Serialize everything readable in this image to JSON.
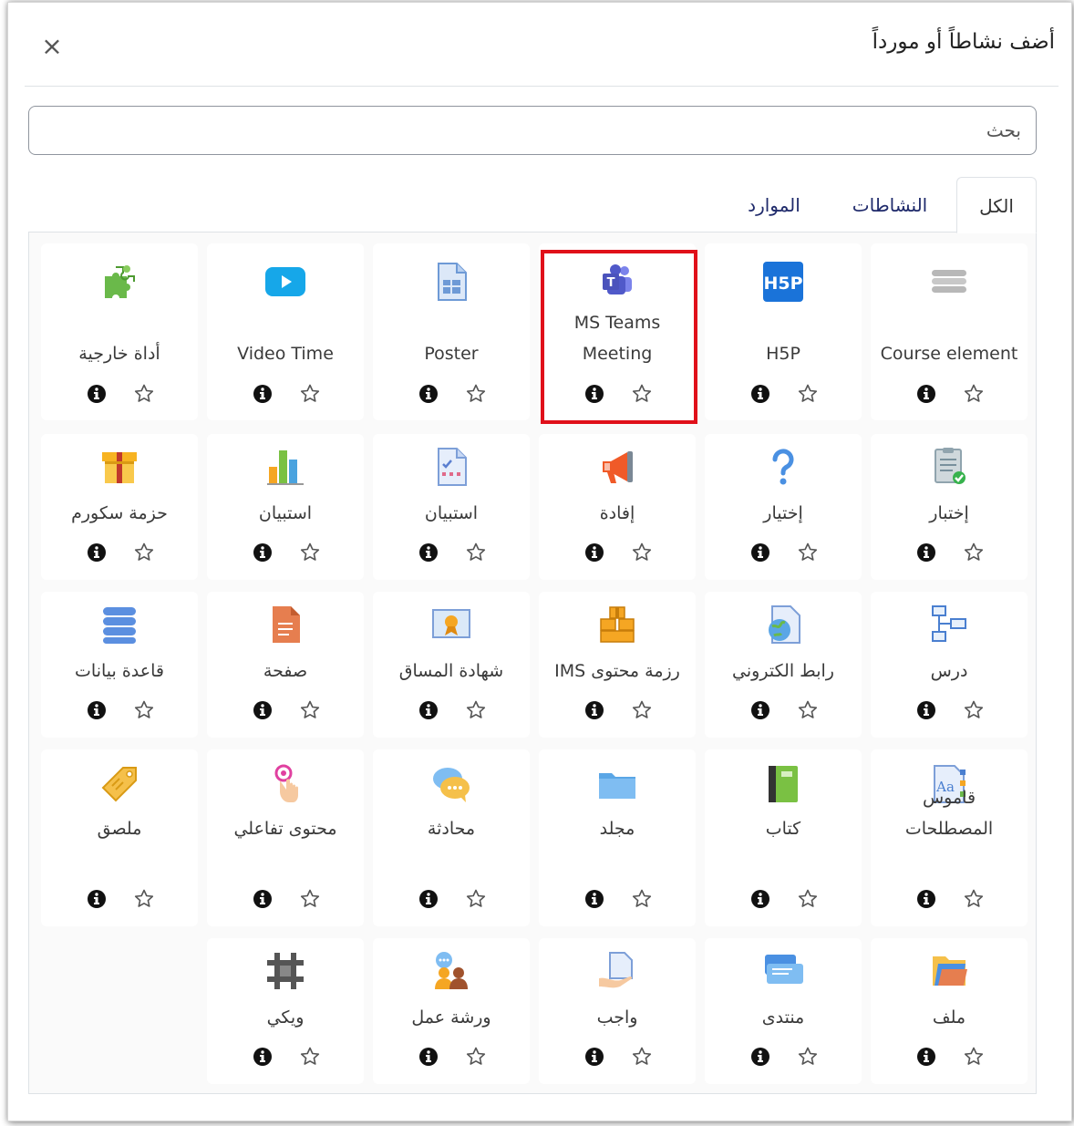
{
  "dialog": {
    "title": "أضف نشاطاً أو مورداً",
    "close_glyph": "×"
  },
  "search": {
    "value": "",
    "placeholder": "بحث"
  },
  "tabs": [
    {
      "label": "الكل",
      "active": true
    },
    {
      "label": "النشاطات",
      "active": false
    },
    {
      "label": "الموارد",
      "active": false
    }
  ],
  "items": [
    {
      "label": "Course element",
      "icon": "course-element-icon"
    },
    {
      "label": "H5P",
      "icon": "h5p-icon"
    },
    {
      "label": "MS Teams Meeting",
      "icon": "ms-teams-icon",
      "highlighted": true
    },
    {
      "label": "Poster",
      "icon": "poster-icon"
    },
    {
      "label": "Video Time",
      "icon": "video-play-icon"
    },
    {
      "label": "أداة خارجية",
      "icon": "puzzle-icon"
    },
    {
      "label": "إختبار",
      "icon": "quiz-icon"
    },
    {
      "label": "إختيار",
      "icon": "question-icon"
    },
    {
      "label": "إفادة",
      "icon": "megaphone-icon"
    },
    {
      "label": "استبيان",
      "icon": "survey-icon"
    },
    {
      "label": "استبيان",
      "icon": "bar-chart-icon"
    },
    {
      "label": "حزمة سكورم",
      "icon": "package-icon"
    },
    {
      "label": "درس",
      "icon": "lesson-icon"
    },
    {
      "label": "رابط الكتروني",
      "icon": "url-icon"
    },
    {
      "label": "رزمة محتوى IMS",
      "icon": "ims-boxes-icon"
    },
    {
      "label": "شهادة المساق",
      "icon": "certificate-icon"
    },
    {
      "label": "صفحة",
      "icon": "page-icon"
    },
    {
      "label": "قاعدة بيانات",
      "icon": "database-icon"
    },
    {
      "label": "قاموس المصطلحات",
      "icon": "glossary-icon"
    },
    {
      "label": "كتاب",
      "icon": "book-icon"
    },
    {
      "label": "مجلد",
      "icon": "folder-icon"
    },
    {
      "label": "محادثة",
      "icon": "chat-icon"
    },
    {
      "label": "محتوى تفاعلي",
      "icon": "touch-icon"
    },
    {
      "label": "ملصق",
      "icon": "label-tag-icon"
    },
    {
      "label": "ملف",
      "icon": "file-icon"
    },
    {
      "label": "منتدى",
      "icon": "forum-icon"
    },
    {
      "label": "واجب",
      "icon": "assignment-icon"
    },
    {
      "label": "ورشة عمل",
      "icon": "workshop-icon"
    },
    {
      "label": "ويكي",
      "icon": "wiki-icon"
    }
  ],
  "colors": {
    "highlight_border": "#e0101a",
    "tab_link": "#1f2a6b",
    "info_icon": "#111111",
    "star_outline": "#555555"
  }
}
